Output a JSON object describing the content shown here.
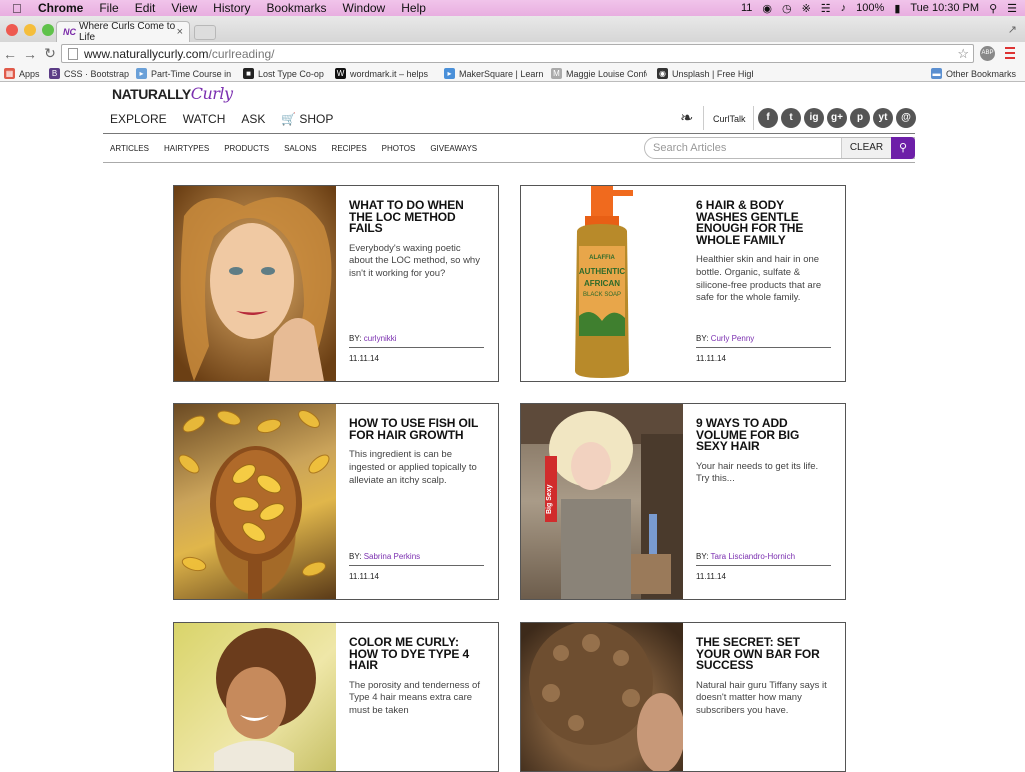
{
  "menubar": {
    "items": [
      "Chrome",
      "File",
      "Edit",
      "View",
      "History",
      "Bookmarks",
      "Window",
      "Help"
    ],
    "battery": "100%",
    "clock": "Tue 10:30 PM",
    "status_num": "11"
  },
  "browser": {
    "tab_title": "Where Curls Come to Life",
    "tab_favicon": "NC",
    "url_host": "www.naturallycurly.com",
    "url_path": "/curlreading/",
    "ext_label": "ABP",
    "bookmarks": [
      {
        "icon": "apps-grid-icon",
        "label": "Apps"
      },
      {
        "icon": "bootstrap-icon",
        "label": "CSS · Bootstrap"
      },
      {
        "icon": "page-icon",
        "label": "Part-Time Course in"
      },
      {
        "icon": "lost-type-icon",
        "label": "Lost Type Co-op"
      },
      {
        "icon": "wordmark-icon",
        "label": "wordmark.it – helps"
      },
      {
        "icon": "makersquare-icon",
        "label": "MakerSquare | Learn"
      },
      {
        "icon": "page-icon",
        "label": "Maggie Louise Confe"
      },
      {
        "icon": "camera-icon",
        "label": "Unsplash | Free High"
      },
      {
        "icon": "folder-icon",
        "label": "Other Bookmarks"
      }
    ]
  },
  "site": {
    "logo_main": "NATURALLY",
    "logo_script": "Curly",
    "main_nav": [
      "EXPLORE",
      "WATCH",
      "ASK",
      "SHOP"
    ],
    "curltalk": "CurlTalk",
    "social": [
      "f",
      "t",
      "ig",
      "g+",
      "p",
      "yt",
      "@"
    ],
    "sub_nav": [
      "ARTICLES",
      "HAIRTYPES",
      "PRODUCTS",
      "SALONS",
      "RECIPES",
      "PHOTOS",
      "GIVEAWAYS"
    ],
    "search_placeholder": "Search Articles",
    "clear_label": "CLEAR"
  },
  "articles": [
    {
      "title": "WHAT TO DO WHEN THE LOC METHOD FAILS",
      "excerpt": "Everybody's waxing poetic about the LOC method, so why isn't it working for you?",
      "by_label": "BY:",
      "author": "curlynikki",
      "date": "11.11.14"
    },
    {
      "title": "6 HAIR & BODY WASHES GENTLE ENOUGH FOR THE WHOLE FAMILY",
      "excerpt": "Healthier skin and hair in one bottle. Organic, sulfate & silicone-free products that are safe for the whole family.",
      "by_label": "BY:",
      "author": "Curly Penny",
      "date": "11.11.14"
    },
    {
      "title": "HOW TO USE FISH OIL FOR HAIR GROWTH",
      "excerpt": "This ingredient is can be ingested or applied topically to alleviate an itchy scalp.",
      "by_label": "BY:",
      "author": "Sabrina Perkins",
      "date": "11.11.14"
    },
    {
      "title": "9 WAYS TO ADD VOLUME FOR BIG SEXY HAIR",
      "excerpt": "Your hair needs to get its life. Try this...",
      "by_label": "BY:",
      "author": "Tara Lisciandro-Hornich",
      "date": "11.11.14"
    },
    {
      "title": "COLOR ME CURLY: HOW TO DYE TYPE 4 HAIR",
      "excerpt": "The porosity and tenderness of Type 4 hair means extra care must be taken",
      "by_label": "",
      "author": "",
      "date": ""
    },
    {
      "title": "THE SECRET: SET YOUR OWN BAR FOR SUCCESS",
      "excerpt": "Natural hair guru Tiffany says it doesn't matter how many subscribers you have.",
      "by_label": "",
      "author": "",
      "date": ""
    }
  ],
  "soap_label": {
    "brand": "ALAFFIA",
    "line1": "AUTHENTIC",
    "line2": "AFRICAN",
    "line3": "BLACK SOAP"
  },
  "spray_label": "Big Sexy",
  "colors": {
    "accent": "#6d1fa8",
    "author": "#7b2fb0"
  }
}
